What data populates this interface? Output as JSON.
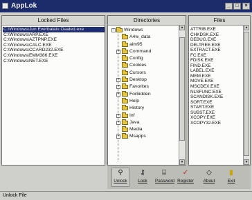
{
  "window": {
    "title": "AppLok"
  },
  "panels": {
    "locked_header": "Locked Files",
    "dirs_header": "Directories",
    "files_header": "Files"
  },
  "locked_files": [
    "C:\\Windows\\Jun Everbalalu Oaaled.exe",
    "C:\\Windows\\ARP.EXE",
    "C:\\Windows\\AZTPNP.EXE",
    "C:\\Windows\\CALC.EXE",
    "C:\\Windows\\CCARD232.EXE",
    "C:\\Windows\\EMM386.EXE",
    "C:\\Windows\\NET.EXE"
  ],
  "directories": [
    {
      "name": "Windows",
      "expander": "−"
    },
    {
      "name": "A4w_data",
      "expander": ""
    },
    {
      "name": "aim95",
      "expander": ""
    },
    {
      "name": "Command",
      "expander": "+"
    },
    {
      "name": "Config",
      "expander": ""
    },
    {
      "name": "Cookies",
      "expander": ""
    },
    {
      "name": "Cursors",
      "expander": ""
    },
    {
      "name": "Desktop",
      "expander": "+"
    },
    {
      "name": "Favorites",
      "expander": "+"
    },
    {
      "name": "Forbidden",
      "expander": "+"
    },
    {
      "name": "Help",
      "expander": ""
    },
    {
      "name": "History",
      "expander": ""
    },
    {
      "name": "Inf",
      "expander": "+"
    },
    {
      "name": "Java",
      "expander": "+"
    },
    {
      "name": "Media",
      "expander": ""
    },
    {
      "name": "Msapps",
      "expander": "+"
    }
  ],
  "files": [
    "ATTRIB.EXE",
    "CHKDSK.EXE",
    "DEBUG.EXE",
    "DELTREE.EXE",
    "EXTRACT.EXE",
    "FC.EXE",
    "FDISK.EXE",
    "FIND.EXE",
    "LABEL.EXE",
    "MEM.EXE",
    "MOVE.EXE",
    "MSCDEX.EXE",
    "NLSFUNC.EXE",
    "SCANDISK.EXE",
    "SORT.EXE",
    "START.EXE",
    "SUBST.EXE",
    "XCOPY.EXE",
    "XCOPY32.EXE"
  ],
  "toolbar": {
    "unlock": {
      "label": "Unlock",
      "icon": "unlock-icon"
    },
    "lock": {
      "label": "Lock",
      "icon": "lock-icon"
    },
    "password": {
      "label": "Password",
      "icon": "password-icon"
    },
    "register": {
      "label": "Register",
      "icon": "register-check-icon"
    },
    "about": {
      "label": "About",
      "icon": "about-icon"
    },
    "exit": {
      "label": "Exit",
      "icon": "exit-icon"
    }
  },
  "status": {
    "text": "Unlock File"
  },
  "colors": {
    "title_bar": "#1c2c6a",
    "selection": "#1f2d73",
    "folder": "#e5c542",
    "register_icon": "#c0202a"
  }
}
